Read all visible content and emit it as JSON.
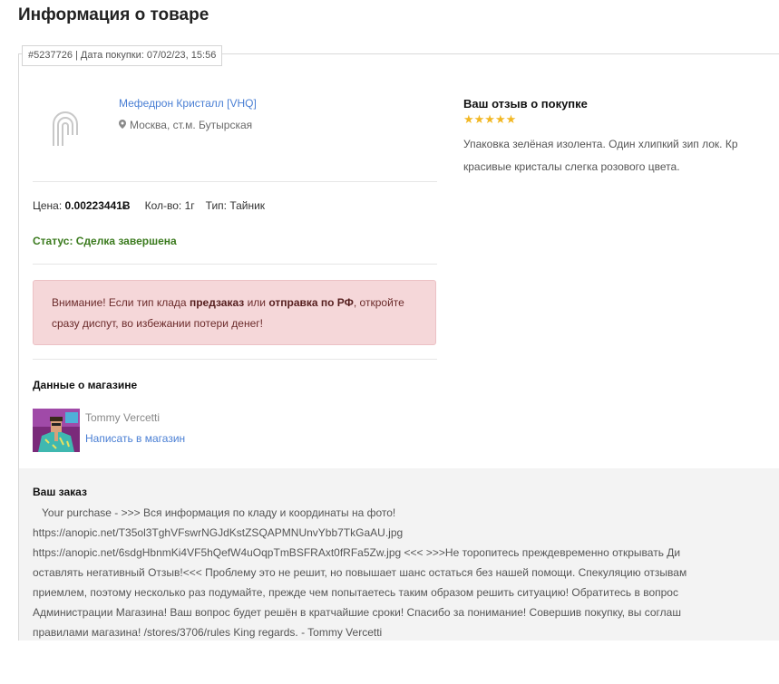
{
  "page": {
    "title": "Информация о товаре"
  },
  "order_meta": "#5237726 | Дата покупки: 07/02/23, 15:56",
  "product": {
    "name": "Мефедрон Кристалл [VHQ]",
    "location": "Москва, ст.м. Бутырская",
    "icons": {
      "logo": "shop-logo-icon",
      "pin": "map-pin-icon"
    }
  },
  "details": {
    "price_label": "Цена:",
    "price_value": "0.00223441Ƀ",
    "qty": "Кол-во: 1г",
    "type": "Тип: Тайник",
    "status": "Статус: Сделка завершена"
  },
  "alert": {
    "part1": "Внимание! Если тип клада ",
    "bold1": "предзаказ",
    "part2": " или ",
    "bold2": "отправка по РФ",
    "part3": ", откройте сразу диспут, во избежании потери денег!"
  },
  "shop": {
    "heading": "Данные о магазине",
    "name": "Tommy Vercetti",
    "message_link": "Написать в магазин"
  },
  "review": {
    "title": "Ваш отзыв о покупке",
    "stars": "★★★★★",
    "rating": 5,
    "text": "Упаковка зелёная изолента. Один хлипкий зип лок. Кр красивые кристалы слегка розового цвета."
  },
  "order": {
    "title": "Ваш заказ",
    "text": "   Your purchase - >>> Вся информация по кладу и координаты на фото!\nhttps://anopic.net/T35ol3TghVFswrNGJdKstZSQAPMNUnvYbb7TkGaAU.jpg\nhttps://anopic.net/6sdgHbnmKi4VF5hQefW4uOqpTmBSFRAxt0fRFa5Zw.jpg <<< >>>Не торопитесь преждевременно открывать Ди\nоставлять негативный Отзыв!<<< Проблему это не решит, но повышает шанс остаться без нашей помощи. Спекуляцию отзывам\nприемлем, поэтому несколько раз подумайте, прежде чем попытаетесь таким образом решить ситуацию! Обратитесь в вопрос\nАдминистрации Магазина! Ваш вопрос будет решён в кратчайшие сроки! Спасибо за понимание! Совершив покупку, вы соглаш\nправилами магазина! /stores/3706/rules King regards. - Tommy Vercetti"
  },
  "colors": {
    "link": "#4a7fd4",
    "status_success": "#3a7a1d",
    "alert_bg": "#f5d7d9",
    "star": "#f2b824",
    "order_bg": "#f3f3f3"
  }
}
